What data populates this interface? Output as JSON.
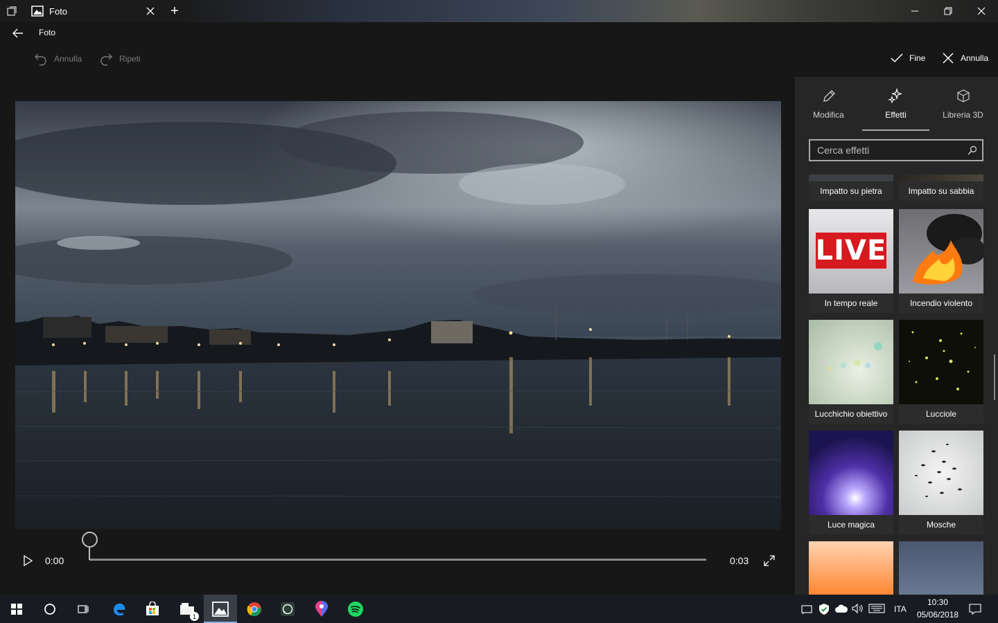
{
  "window": {
    "tab_title": "Foto",
    "new_tab": "+",
    "app_title": "Foto"
  },
  "commands": {
    "undo_label": "Annulla",
    "redo_label": "Ripeti",
    "done_label": "Fine",
    "cancel_label": "Annulla"
  },
  "player": {
    "current_time": "0:00",
    "duration": "0:03",
    "progress": 0
  },
  "panel": {
    "tabs": [
      {
        "label": "Modifica",
        "icon": "pencil-icon",
        "active": false
      },
      {
        "label": "Effetti",
        "icon": "sparkle-icon",
        "active": true
      },
      {
        "label": "Libreria 3D",
        "icon": "cube-icon",
        "active": false
      }
    ],
    "search_placeholder": "Cerca effetti",
    "effects": [
      {
        "label": "Impatto su pietra"
      },
      {
        "label": "Impatto su sabbia"
      },
      {
        "label": "In tempo reale",
        "thumb_text": "LIVE"
      },
      {
        "label": "Incendio violento"
      },
      {
        "label": "Lucchichio obiettivo"
      },
      {
        "label": "Lucciole"
      },
      {
        "label": "Luce magica"
      },
      {
        "label": "Mosche"
      }
    ]
  },
  "taskbar": {
    "apps": [
      "start-icon",
      "cortana-icon",
      "task-view-icon",
      "edge-icon",
      "store-icon",
      "file-explorer-icon",
      "photos-icon",
      "chrome-icon",
      "whatsapp-icon",
      "maps-icon",
      "spotify-icon"
    ],
    "explorer_badge": "1",
    "language": "ITA",
    "time": "10:30",
    "date": "05/06/2018"
  }
}
